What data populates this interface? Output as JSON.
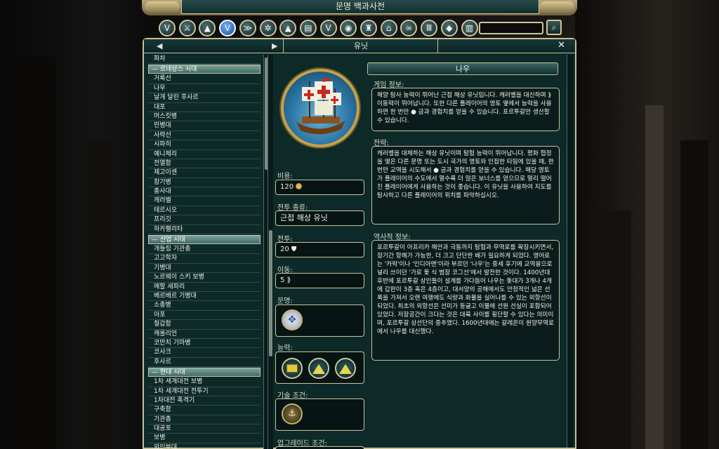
{
  "window": {
    "title": "문명 백과사전"
  },
  "categories": [
    {
      "icon": "v-emblem-icon",
      "glyph": "V"
    },
    {
      "icon": "spear-icon",
      "glyph": "⚔"
    },
    {
      "icon": "dome-icon",
      "glyph": "▲"
    },
    {
      "icon": "civilopedia-v-icon",
      "glyph": "V",
      "active": true
    },
    {
      "icon": "chevron-rank-icon",
      "glyph": "≫"
    },
    {
      "icon": "gear-icon",
      "glyph": "✲"
    },
    {
      "icon": "pyramid-icon",
      "glyph": "▲"
    },
    {
      "icon": "book-icon",
      "glyph": "▤"
    },
    {
      "icon": "shield-v-icon",
      "glyph": "V"
    },
    {
      "icon": "globe-icon",
      "glyph": "◉"
    },
    {
      "icon": "bell-icon",
      "glyph": "♜"
    },
    {
      "icon": "temple-icon",
      "glyph": "⌂"
    },
    {
      "icon": "handshake-icon",
      "glyph": "∞"
    },
    {
      "icon": "columns-icon",
      "glyph": "Ⅲ"
    },
    {
      "icon": "drop-icon",
      "glyph": "◆"
    },
    {
      "icon": "scroll-icon",
      "glyph": "▥"
    }
  ],
  "search": {
    "placeholder": ""
  },
  "nav": {
    "title": "유닛",
    "prev": "◀",
    "next": "▶",
    "close": "✕"
  },
  "unit_list": [
    {
      "type": "item",
      "label": "화차"
    },
    {
      "type": "header",
      "label": "르네상스 시대"
    },
    {
      "type": "item",
      "label": "거룩선"
    },
    {
      "type": "item",
      "label": "나우"
    },
    {
      "type": "item",
      "label": "날개 달린 후사르"
    },
    {
      "type": "item",
      "label": "대포"
    },
    {
      "type": "item",
      "label": "머스킷병"
    },
    {
      "type": "item",
      "label": "민병대"
    },
    {
      "type": "item",
      "label": "사략선"
    },
    {
      "type": "item",
      "label": "시파히"
    },
    {
      "type": "item",
      "label": "예니체리"
    },
    {
      "type": "item",
      "label": "전열함"
    },
    {
      "type": "item",
      "label": "제고이센"
    },
    {
      "type": "item",
      "label": "창기병"
    },
    {
      "type": "item",
      "label": "총사대"
    },
    {
      "type": "item",
      "label": "캐러벨"
    },
    {
      "type": "item",
      "label": "테르시오"
    },
    {
      "type": "item",
      "label": "프리깃"
    },
    {
      "type": "item",
      "label": "하카펠리타"
    },
    {
      "type": "header",
      "label": "산업 시대"
    },
    {
      "type": "item",
      "label": "개틀링 기관총"
    },
    {
      "type": "item",
      "label": "고고학자"
    },
    {
      "type": "item",
      "label": "기병대"
    },
    {
      "type": "item",
      "label": "노르웨이 스키 보병"
    },
    {
      "type": "item",
      "label": "메할 세파리"
    },
    {
      "type": "item",
      "label": "베르베르 기병대"
    },
    {
      "type": "item",
      "label": "소총병"
    },
    {
      "type": "item",
      "label": "아포"
    },
    {
      "type": "item",
      "label": "철갑함"
    },
    {
      "type": "item",
      "label": "캐롤리언"
    },
    {
      "type": "item",
      "label": "코만치 기마병"
    },
    {
      "type": "item",
      "label": "코사크"
    },
    {
      "type": "item",
      "label": "후사르"
    },
    {
      "type": "header",
      "label": "현대 시대"
    },
    {
      "type": "item",
      "label": "1차 세계대전 보병"
    },
    {
      "type": "item",
      "label": "1차 세계대전 전투기"
    },
    {
      "type": "item",
      "label": "1차대전 폭격기"
    },
    {
      "type": "item",
      "label": "구축함"
    },
    {
      "type": "item",
      "label": "기관총"
    },
    {
      "type": "item",
      "label": "대공포"
    },
    {
      "type": "item",
      "label": "보병"
    },
    {
      "type": "item",
      "label": "외인부대"
    }
  ],
  "unit": {
    "name": "나우",
    "cost_label": "비용:",
    "cost_value": "120",
    "combat_type_label": "전투 종류:",
    "combat_type_value": "근접 해상 유닛",
    "strength_label": "전투:",
    "strength_value": "20",
    "movement_label": "이동:",
    "movement_value": "5",
    "civ_label": "문명:",
    "abilities_label": "능력:",
    "tech_label": "기술 조건:",
    "upgrade_label": "업그레이드 조건:"
  },
  "sections": {
    "game_info_label": "게임 정보:",
    "game_info_text": "해양 탐사 능력이 뛰어난 근접 해상 유닛입니다. 캐러벨을 대신하며 ⟫ 이동력이 뛰어납니다. 또한 다른 플레이어의 영토 옆에서 능력을 사용하면 한 번만 ● 금과 경험치를 얻을 수 있습니다. 포르투갈만 생산할 수 있습니다.",
    "strategy_label": "전략:",
    "strategy_text": "캐러벨을 대체하는 해상 유닛이며 탐험 능력이 뛰어납니다. 평화 협정을 맺은 다른 문명 또는 도시 국가의 영토와 인접한 타일에 있을 때, 한 번만 교역을 시도해서 ● 금과 경험치를 얻을 수 있습니다. 해당 영토가 플레이어의 수도에서 멀수록 더 많은 보너스를 얻으므로 멀리 떨어진 플레이어에게 사용하는 것이 좋습니다. 이 유닛을 사용하여 지도를 탐사하고 다른 플레이어의 위치를 파악하십시오.",
    "history_label": "역사적 정보:",
    "history_text": "포르투갈이 아프리카 해안과 극동까지 탐험과 무역로를 확장시키면서, 장기간 항해가 가능한, 더 크고 단단한 배가 필요하게 되었다. 영어로는 '카락'이나 '인디아맨'이라 부르던 '나우'는 중세 후기에 교역용으로 널리 쓰이던 '가로 돛 식 범장 코그선'에서 발전한 것이다. 1400년대 후반에 포르투갈 상인들이 설계를 가다듬어 나우는 돛대가 3개나 4개에 갑판이 3층 혹은 4층이고, 대서양의 공해에서도 안정적인 넓은 선폭을 가져서 오랜 여행에도 식량과 화물을 실어나를 수 있는 외항선이 되었다. 최초의 외항선은 선미가 둥글고 이물에 선원 선실이 포함되어 있었다. 저장공간이 크다는 것은 대륙 사이를 횡단할 수 있다는 의미이며, 포르투갈 상선단의 중추였다. 1600년대에는 갈레온이 원양무역로에서 나우를 대신했다."
  },
  "colors": {
    "panel": "#0d2a29",
    "border": "#c9bf94",
    "accent_gold": "#e7d54b",
    "active_category": "#3a7fd8"
  }
}
